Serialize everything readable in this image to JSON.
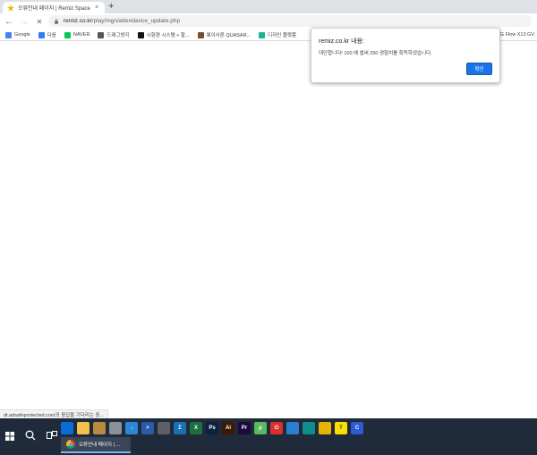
{
  "tab": {
    "title": "오류안내 페이지 | Remiz Space",
    "close": "×",
    "new_tab": "+"
  },
  "toolbar": {
    "back": "←",
    "forward": "→",
    "reload": "✕",
    "url_host": "remiz.co.kr",
    "url_path": "/play/mgn/attendance_update.php"
  },
  "bookmarks": [
    {
      "label": "Google",
      "color": "#4285f4"
    },
    {
      "label": "다음",
      "color": "#2f7df6"
    },
    {
      "label": "NAVER",
      "color": "#03c75a"
    },
    {
      "label": "드래그방지",
      "color": "#555555"
    },
    {
      "label": "시험편 시스템 + 할...",
      "color": "#111111"
    },
    {
      "label": "웨이사론 QUASAR...",
      "color": "#7a4e2a"
    },
    {
      "label": "디자인 플랫폼",
      "color": "#18b59a"
    }
  ],
  "bookmarks_right": "G Flow X13 GV.",
  "dialog": {
    "title": "remiz.co.kr 내용:",
    "message": "대단합니다! 100 에 벌써 250 경험치를 획득하셨습니다.",
    "ok_label": "확인"
  },
  "status_text": "dt.adsafeprotected.com의 응답을 기다리는 중...",
  "taskbar": {
    "running_label": "오류안내 페이지 | ...",
    "pinned": [
      {
        "name": "mail-icon",
        "color": "#0a6cd8",
        "glyph": ""
      },
      {
        "name": "file-explorer-icon",
        "color": "#f2c14e",
        "glyph": ""
      },
      {
        "name": "package-icon",
        "color": "#b98a3c",
        "glyph": ""
      },
      {
        "name": "drive-icon",
        "color": "#8a8f98",
        "glyph": ""
      },
      {
        "name": "download-icon",
        "color": "#2b88d8",
        "glyph": "↓"
      },
      {
        "name": "powershell-icon",
        "color": "#2a5aa8",
        "glyph": ">"
      },
      {
        "name": "calculator-icon",
        "color": "#5a5f68",
        "glyph": ""
      },
      {
        "name": "terminal-icon",
        "color": "#1b6fb5",
        "glyph": "Σ"
      },
      {
        "name": "excel-icon",
        "color": "#1d6f42",
        "glyph": "X"
      },
      {
        "name": "photoshop-icon",
        "color": "#0c2340",
        "glyph": "Ps"
      },
      {
        "name": "illustrator-icon",
        "color": "#3d1a00",
        "glyph": "Ai"
      },
      {
        "name": "premiere-icon",
        "color": "#1a0a3d",
        "glyph": "Pr"
      },
      {
        "name": "torrent-icon",
        "color": "#5cb85c",
        "glyph": "μ"
      },
      {
        "name": "power-icon",
        "color": "#d9302c",
        "glyph": "⏻"
      },
      {
        "name": "app-icon",
        "color": "#2b7fd1",
        "glyph": ""
      },
      {
        "name": "edge-icon",
        "color": "#0f8c8c",
        "glyph": ""
      },
      {
        "name": "chrome-icon",
        "color": "#e8b400",
        "glyph": ""
      },
      {
        "name": "kakaotalk-icon",
        "color": "#f9e000",
        "glyph": "T"
      },
      {
        "name": "settings-app-icon",
        "color": "#2d5bd3",
        "glyph": "C"
      }
    ]
  }
}
